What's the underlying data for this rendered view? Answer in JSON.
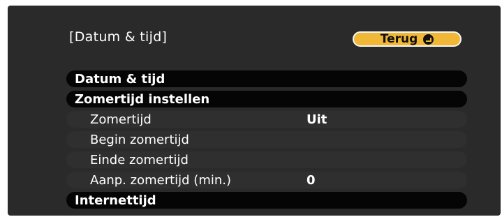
{
  "screen_title": "[Datum & tijd]",
  "back_button": {
    "label": "Terug"
  },
  "menu": {
    "items": [
      {
        "label": "Datum & tijd",
        "value": ""
      },
      {
        "label": "Zomertijd instellen",
        "value": ""
      },
      {
        "label": "Zomertijd",
        "value": "Uit"
      },
      {
        "label": "Begin zomertijd",
        "value": ""
      },
      {
        "label": "Einde zomertijd",
        "value": ""
      },
      {
        "label": "Aanp. zomertijd (min.)",
        "value": "0"
      },
      {
        "label": "Internettijd",
        "value": ""
      }
    ]
  },
  "colors": {
    "panel": "#2a2a2a",
    "header_row": "#050505",
    "sub_row": "#2f2f2f",
    "accent_button": "#f1b736"
  },
  "icons": {
    "back": "enter-return-icon"
  }
}
